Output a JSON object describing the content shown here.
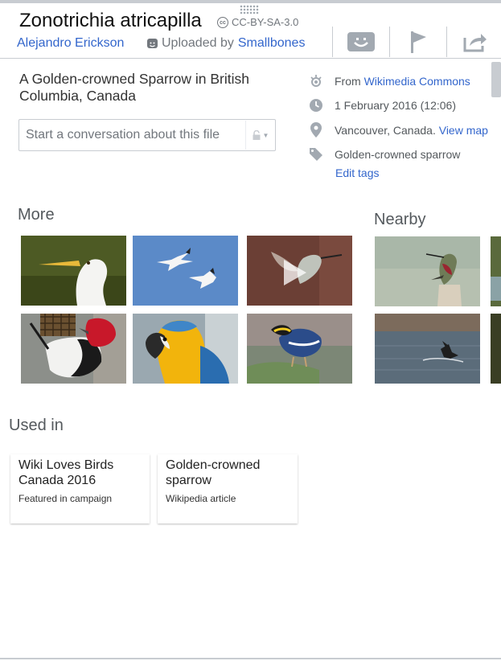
{
  "header": {
    "title": "Zonotrichia atricapilla",
    "license": "CC-BY-SA-3.0",
    "author": "Alejandro Erickson",
    "uploaded_prefix": "Uploaded by",
    "uploader": "Smallbones",
    "actions": [
      "thanks-icon",
      "flag-icon",
      "share-icon"
    ]
  },
  "description": "A Golden-crowned Sparrow in British Columbia, Canada",
  "conversation": {
    "placeholder": "Start a conversation about this file"
  },
  "meta": {
    "source_prefix": "From",
    "source": "Wikimedia Commons",
    "date": "1 February 2016 (12:06)",
    "location": "Vancouver, Canada.",
    "view_map": "View map",
    "tag": "Golden-crowned sparrow",
    "edit_tags": "Edit tags"
  },
  "more": {
    "title": "More",
    "thumbs": [
      "egret",
      "snow-geese",
      "hummingbird-video",
      "red-headed-woodpecker",
      "macaw",
      "pitta"
    ]
  },
  "nearby": {
    "title": "Nearby",
    "thumbs": [
      "hummingbird-on-post",
      "bird-taking-off-water"
    ]
  },
  "used_in": {
    "title": "Used in",
    "cards": [
      {
        "title": "Wiki Loves Birds Canada 2016",
        "subtitle": "Featured in campaign"
      },
      {
        "title": "Golden-crowned sparrow",
        "subtitle": "Wikipedia article"
      }
    ]
  },
  "colors": {
    "link": "#3366cc",
    "border": "#c8ccd1",
    "muted": "#72777d"
  }
}
